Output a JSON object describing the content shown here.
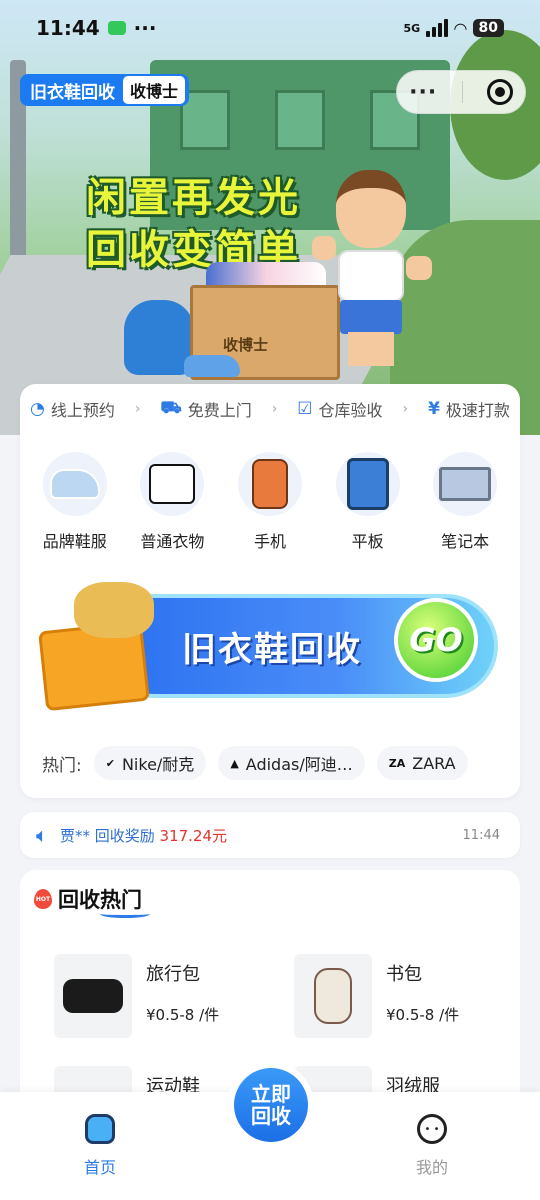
{
  "status_bar": {
    "time": "11:44",
    "dots": "···",
    "network": "5G",
    "battery": "80"
  },
  "header": {
    "app_name": "旧衣鞋回收",
    "brand_tag": "收博士",
    "more_icon": "···"
  },
  "hero": {
    "slogan_line1": "闲置再发光",
    "slogan_line2": "回收变简单",
    "box_label": "收博士"
  },
  "steps": [
    {
      "label": "线上预约",
      "icon": "clock-icon"
    },
    {
      "label": "免费上门",
      "icon": "truck-icon"
    },
    {
      "label": "仓库验收",
      "icon": "check-icon"
    },
    {
      "label": "极速打款",
      "icon": "yen-icon"
    }
  ],
  "categories": [
    {
      "label": "品牌鞋服",
      "icon": "sneaker-icon"
    },
    {
      "label": "普通衣物",
      "icon": "tshirt-icon"
    },
    {
      "label": "手机",
      "icon": "phone-icon"
    },
    {
      "label": "平板",
      "icon": "tablet-icon"
    },
    {
      "label": "笔记本",
      "icon": "laptop-icon"
    }
  ],
  "banner": {
    "title": "旧衣鞋回收",
    "go_label": "GO"
  },
  "hot_brands": {
    "label": "热门:",
    "chips": [
      {
        "label": "Nike/耐克",
        "logo": "✔"
      },
      {
        "label": "Adidas/阿迪…",
        "logo": "▲"
      },
      {
        "label": "ZARA",
        "logo": "ZA"
      }
    ]
  },
  "notice": {
    "prefix": "贾** 回收奖励 ",
    "amount": "317.24",
    "suffix": "元",
    "time": "11:44"
  },
  "hot_section": {
    "fire_badge": "HOT",
    "title": "回收热门",
    "items": [
      {
        "name": "旅行包",
        "price": "¥0.5-8 /件"
      },
      {
        "name": "书包",
        "price": "¥0.5-8 /件"
      },
      {
        "name": "运动鞋"
      },
      {
        "name": "羽绒服"
      }
    ]
  },
  "fab": {
    "label": "立即回收"
  },
  "tabbar": {
    "home": "首页",
    "mine": "我的"
  },
  "colors": {
    "accent": "#2f7be6",
    "price_red": "#e2352f",
    "slogan_yellow": "#e8f53a",
    "go_green": "#3fcb2c"
  }
}
